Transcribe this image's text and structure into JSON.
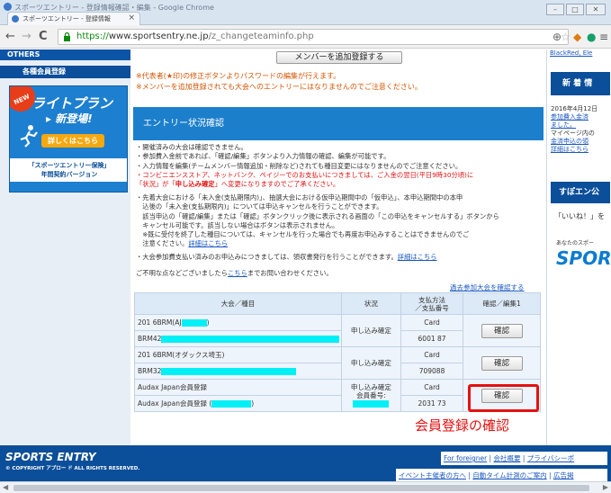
{
  "window": {
    "title": "スポーツエントリー - 登録情報確認・編集 - Google Chrome",
    "tab_label": "スポーツエントリー - 登録情報",
    "tab_close": "×",
    "min": "–",
    "max": "□",
    "close": "✕"
  },
  "toolbar": {
    "back": "←",
    "forward": "→",
    "reload": "C",
    "url_scheme": "https://",
    "url_host": "www.sportsentry.ne.jp",
    "url_path": "/z_changeteaminfo.php",
    "menu": "≡"
  },
  "left": {
    "others": "OTHERS",
    "member_reg": "各種会員登録",
    "ad": {
      "new_badge": "NEW",
      "title": "ライトプラン",
      "subtitle": "新登場!",
      "button": "詳しくはこちら",
      "caption1": "「スポーツエントリー保険」",
      "caption2": "年間契約バージョン"
    }
  },
  "main": {
    "add_member_button": "メンバーを追加登録する",
    "note1": "※代表者(★印)の修正ボタンよりパスワードの編集が行えます。",
    "note2": "※メンバーを追加登録されても大会へのエントリーにはなりませんのでご注意ください。",
    "section_title": "エントリー状況確認",
    "bullets_a": [
      "・開催済みの大会は確認できません。",
      "・参加費入金前であれば、「確認/編集」ボタンより入力情報の確認、編集が可能です。",
      "・入力情報を編集(チームメンバー情報追加・削除など)されても種目変更にはなりませんのでご注意ください。"
    ],
    "bullet_red1": "・コンビニエンスストア、ネットバンク、ペイジーでのお支払いにつきましては、ご入金の翌日(平日9時30分頃)に",
    "bullet_red2a": "「状況」が「",
    "bullet_red2b": "申し込み確定",
    "bullet_red2c": "」へ変更になりますのでご了承ください。",
    "bullets_b": [
      "・先着大会における「未入金(支払期限内)」、抽選大会における仮申込期間中の「仮申込」、本申込期間中の本申",
      "　込後の「未入金(支払期限内)」については申込キャンセルを行うことができます。",
      "　該当申込の「確認/編集」または「確認」ボタンクリック後に表示される画面の「この申込をキャンセルする」ボタンから",
      "　キャンセル可能です。該当しない場合はボタンは表示されません。",
      "　※既に受付を終了した種目については、キャンセルを行った場合でも再度お申込みすることはできませんのでご",
      "　注意ください。"
    ],
    "detail_link": "詳細はこちら",
    "receipt_note": "・大会参加費支払い済みのお申込みにつきましては、領収書発行を行うことができます。",
    "receipt_link": "詳細はこちら",
    "inquiry_pre": "ご不明な点などございましたら",
    "inquiry_link": "こちら",
    "inquiry_post": "までお問い合わせください。",
    "past_link": "過去参加大会を確認する",
    "table": {
      "headers": [
        "大会／種目",
        "状況",
        "支払方法\n／支払番号",
        "確認／編集1"
      ],
      "rows": [
        {
          "event": "201 6BRM(AJ",
          "event_tail": ")",
          "category": "BRM42",
          "status": "申し込み確定",
          "pay_method": "Card",
          "pay_no": "6001 87",
          "button": "確認"
        },
        {
          "event": "201 6BRM(オダックス埼玉)",
          "event_tail": "",
          "category": "BRM32",
          "status": "申し込み確定",
          "pay_method": "Card",
          "pay_no": "709088",
          "button": "確認"
        },
        {
          "event": "Audax Japan会員登録",
          "event_tail": "",
          "category": "Audax Japan会員登録 (",
          "category_tail": ")",
          "status": "申し込み確定\n会員番号:",
          "pay_method": "Card",
          "pay_no": "2031 73",
          "button": "確認"
        }
      ]
    },
    "annotation": "会員登録の確認"
  },
  "right": {
    "top_links": "BlackRed, Ele",
    "news_header": "新 着 情",
    "news_lines": [
      "2016年4月12日",
      "参加費入金済",
      "ました。",
      "マイページ内の",
      "金済申込の領",
      "詳細はこちら"
    ],
    "subti_header": "すぽエン公",
    "iine": "「いいね！」を",
    "ad_text": "あなたのスポー",
    "logo": "SPOR"
  },
  "footer": {
    "logo": "SPORTS ENTRY",
    "copyright": "© COPYRIGHT アプロー ド ALL RIGHTS RESERVED.",
    "links1": [
      "For foreigner",
      "会社概要",
      "プライバシーポ"
    ],
    "links2": [
      "イベント主催者の方へ",
      "自動タイム計測のご案内",
      "広告掲"
    ]
  }
}
